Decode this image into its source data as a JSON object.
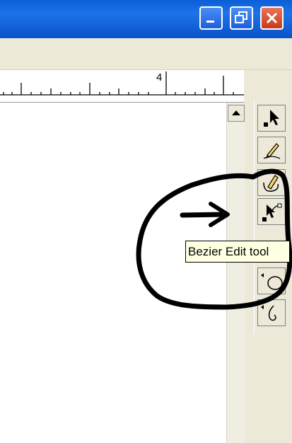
{
  "window": {
    "controls": [
      "minimize-icon",
      "maximize-icon",
      "close-icon"
    ]
  },
  "ruler": {
    "label": "4"
  },
  "tooltip": {
    "text": "Bezier Edit tool"
  },
  "tools": [
    {
      "name": "pick-tool",
      "icon": "arrow-pointer-icon"
    },
    {
      "name": "freehand-tool",
      "icon": "pencil-icon"
    },
    {
      "name": "artistic-media-tool",
      "icon": "pen-curve-icon"
    },
    {
      "name": "bezier-edit-tool",
      "icon": "node-edit-icon"
    },
    {
      "name": "ellipse-tool",
      "icon": "ellipse-icon"
    },
    {
      "name": "spiral-tool",
      "icon": "spiral-icon"
    }
  ],
  "colors": {
    "titlebar": "#0a5fd8",
    "chrome": "#ece9d8",
    "tooltip_bg": "#ffffe1",
    "annotation": "#000000"
  }
}
